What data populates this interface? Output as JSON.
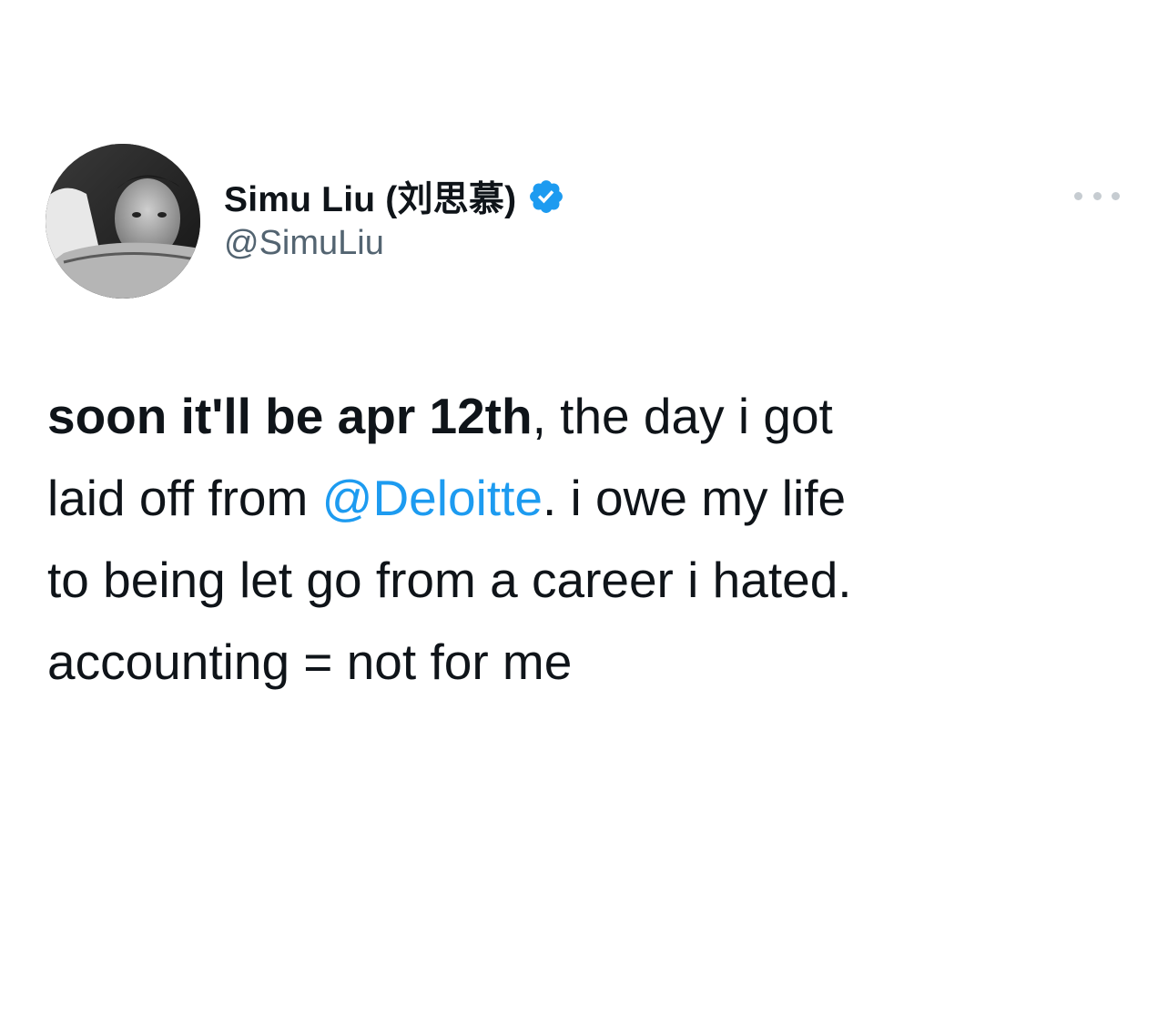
{
  "author": {
    "display_name": "Simu Liu (刘思慕)",
    "handle": "@SimuLiu",
    "verified": true,
    "avatar_icon": "profile-photo"
  },
  "menu": {
    "icon": "more-options-icon"
  },
  "tweet": {
    "line1_bold": "soon it'll be apr 12th",
    "line1_rest": ", the day i got",
    "line2_start": "laid off from ",
    "line2_mention": "@Deloitte",
    "line2_end": ". i owe my life",
    "line3": "to being let go from a career i hated.",
    "line4": "accounting = not for me"
  },
  "colors": {
    "link": "#1d9bf0",
    "verified_badge": "#1d9bf0",
    "handle": "#536471",
    "text": "#0f1419"
  }
}
